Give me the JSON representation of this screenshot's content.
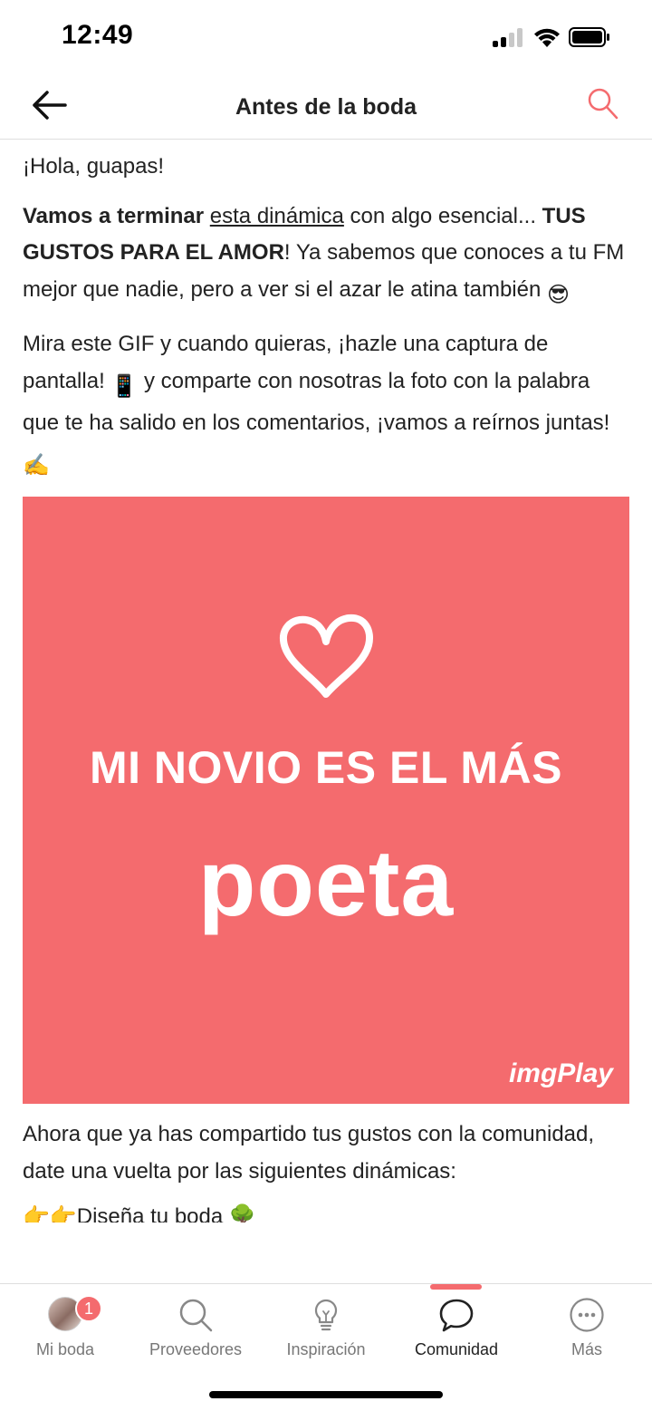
{
  "status": {
    "time": "12:49"
  },
  "header": {
    "title": "Antes de la boda"
  },
  "post": {
    "greeting": "¡Hola, guapas!",
    "p1_b1": "Vamos a terminar",
    "p1_link": "esta dinámica",
    "p1_t1": " con algo esencial... ",
    "p1_b2": "TUS GUSTOS PARA EL AMOR",
    "p1_t2": "! Ya sabemos que conoces a tu FM mejor que nadie, pero a ver si el azar le atina también",
    "p1_emoji": "😎",
    "p2_t1": "Mira este GIF y cuando quieras, ¡hazle una captura de pantalla!",
    "p2_emoji1": "📱",
    "p2_t2": " y comparte con nosotras la foto con la palabra que te ha salido en los comentarios, ¡vamos a reírnos juntas!",
    "p2_emoji2": "✍️",
    "gif": {
      "line1": "MI NOVIO ES EL MÁS",
      "word": "poeta",
      "watermark": "imgPlay",
      "background": "#f46b6e"
    },
    "p3": "Ahora que ya has compartido tus gustos con la comunidad, date una vuelta por las siguientes dinámicas:",
    "cutoff": "👉👉Diseña tu boda 🌳"
  },
  "nav": {
    "items": [
      {
        "label": "Mi boda",
        "icon": "avatar",
        "badge": "1"
      },
      {
        "label": "Proveedores",
        "icon": "search-icon"
      },
      {
        "label": "Inspiración",
        "icon": "lightbulb-icon"
      },
      {
        "label": "Comunidad",
        "icon": "chat-bubble-icon",
        "active": true
      },
      {
        "label": "Más",
        "icon": "more-icon"
      }
    ]
  },
  "colors": {
    "accent": "#f46b6e",
    "text": "#222222",
    "muted": "#777777"
  }
}
